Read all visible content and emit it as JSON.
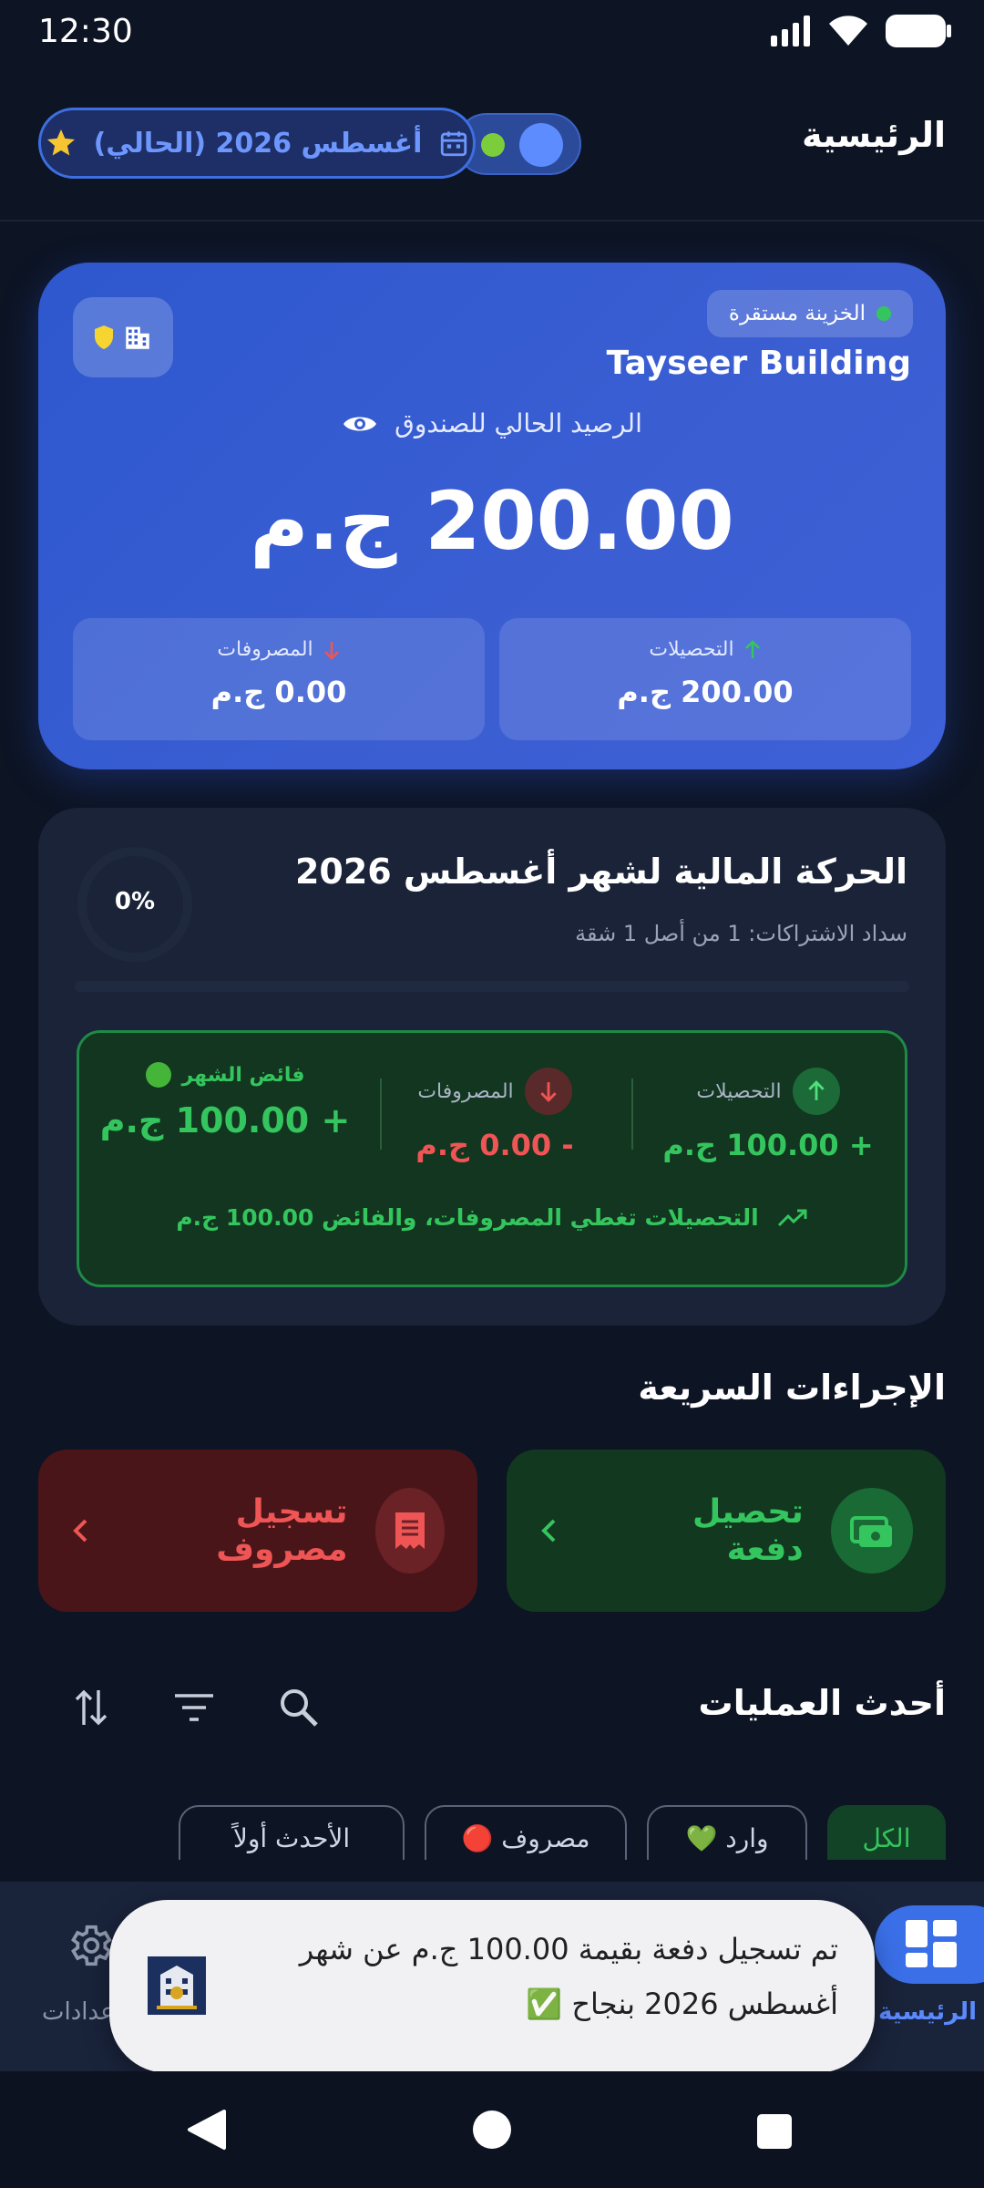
{
  "status_bar": {
    "time": "12:30"
  },
  "header": {
    "title": "الرئيسية",
    "month_chip_label": "أغسطس 2026 (الحالي)"
  },
  "balance_card": {
    "treasury_status": "الخزينة مستقرة",
    "building_name": "Tayseer Building",
    "balance_label": "الرصيد الحالي للصندوق",
    "balance_amount": "200.00 ج.م",
    "collections_label": "التحصيلات",
    "collections_value": "200.00 ج.م",
    "expenses_label": "المصروفات",
    "expenses_value": "0.00 ج.م"
  },
  "monthly_card": {
    "title": "الحركة المالية لشهر أغسطس 2026",
    "subtitle": "سداد الاشتراكات: 1 من أصل 1 شقة",
    "progress_text": "0%",
    "progress_fraction": 0,
    "collections_label": "التحصيلات",
    "collections_value": "+ 100.00 ج.م",
    "expenses_label": "المصروفات",
    "expenses_value": "- 0.00 ج.م",
    "surplus_label": "فائض الشهر",
    "surplus_value": "+ 100.00 ج.م",
    "footer_note": "التحصيلات تغطي المصروفات، والفائض 100.00 ج.م"
  },
  "quick_actions": {
    "title": "الإجراءات السريعة",
    "collect_label": "تحصيل دفعة",
    "expense_label": "تسجيل مصروف"
  },
  "recent_ops": {
    "title": "أحدث العمليات",
    "filters": [
      "الكل",
      "وارد 💚",
      "مصروف 🔴",
      "الأحدث أولاً"
    ]
  },
  "bottom_nav": {
    "home_label": "الرئيسية",
    "settings_label": "الإعدادات"
  },
  "toast": {
    "message": "تم تسجيل دفعة بقيمة 100.00 ج.م عن شهر أغسطس 2026 بنجاح ✅"
  },
  "colors": {
    "accent": "#3b6fe8",
    "success": "#34c55e",
    "danger": "#e5484d"
  }
}
